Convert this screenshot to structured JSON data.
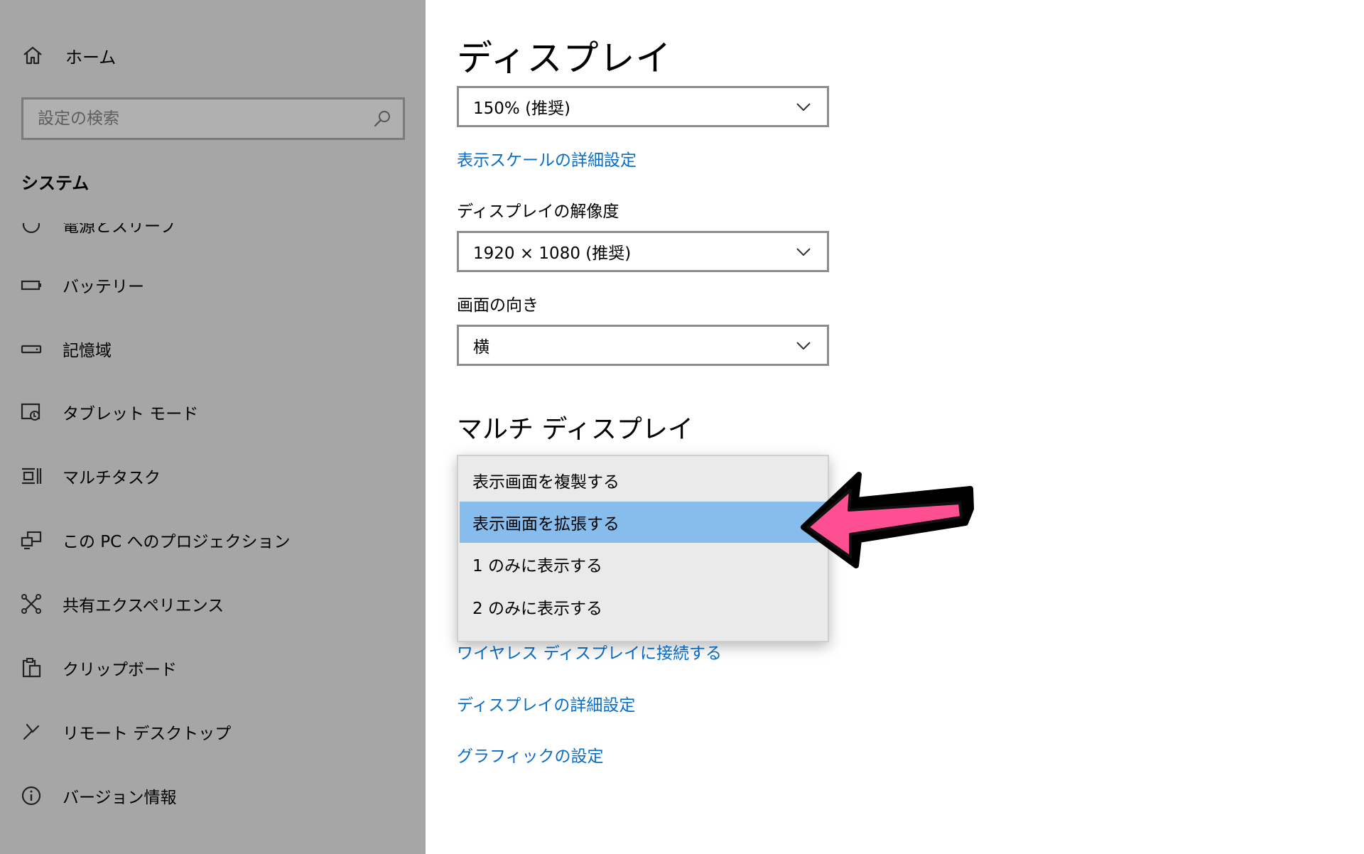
{
  "sidebar": {
    "home": {
      "label": "ホーム",
      "icon": "home-icon"
    },
    "search": {
      "placeholder": "設定の検索",
      "icon": "search-icon"
    },
    "section_title": "システム",
    "items": [
      {
        "label": "電源とスリープ",
        "icon": "power-icon"
      },
      {
        "label": "バッテリー",
        "icon": "battery-icon"
      },
      {
        "label": "記憶域",
        "icon": "storage-icon"
      },
      {
        "label": "タブレット モード",
        "icon": "tablet-mode-icon"
      },
      {
        "label": "マルチタスク",
        "icon": "multitasking-icon"
      },
      {
        "label": "この PC へのプロジェクション",
        "icon": "projection-icon"
      },
      {
        "label": "共有エクスペリエンス",
        "icon": "shared-experience-icon"
      },
      {
        "label": "クリップボード",
        "icon": "clipboard-icon"
      },
      {
        "label": "リモート デスクトップ",
        "icon": "remote-desktop-icon"
      },
      {
        "label": "バージョン情報",
        "icon": "info-icon"
      }
    ]
  },
  "main": {
    "title": "ディスプレイ",
    "scale": {
      "value": "150% (推奨)"
    },
    "scale_link": "表示スケールの詳細設定",
    "resolution": {
      "label": "ディスプレイの解像度",
      "value": "1920 × 1080 (推奨)"
    },
    "orientation": {
      "label": "画面の向き",
      "value": "横"
    },
    "multi_display": {
      "title": "マルチ ディスプレイ",
      "options": [
        "表示画面を複製する",
        "表示画面を拡張する",
        "1 のみに表示する",
        "2 のみに表示する"
      ],
      "highlighted_option": "表示画面を拡張する"
    },
    "links": {
      "wireless": "ワイヤレス ディスプレイに接続する",
      "advanced": "ディスプレイの詳細設定",
      "graphics": "グラフィックの設定"
    }
  },
  "colors": {
    "sidebar_bg": "#a6a6a6",
    "link": "#0a6ec8",
    "highlight": "#86bdec",
    "arrow_fill": "#ff4f93"
  }
}
